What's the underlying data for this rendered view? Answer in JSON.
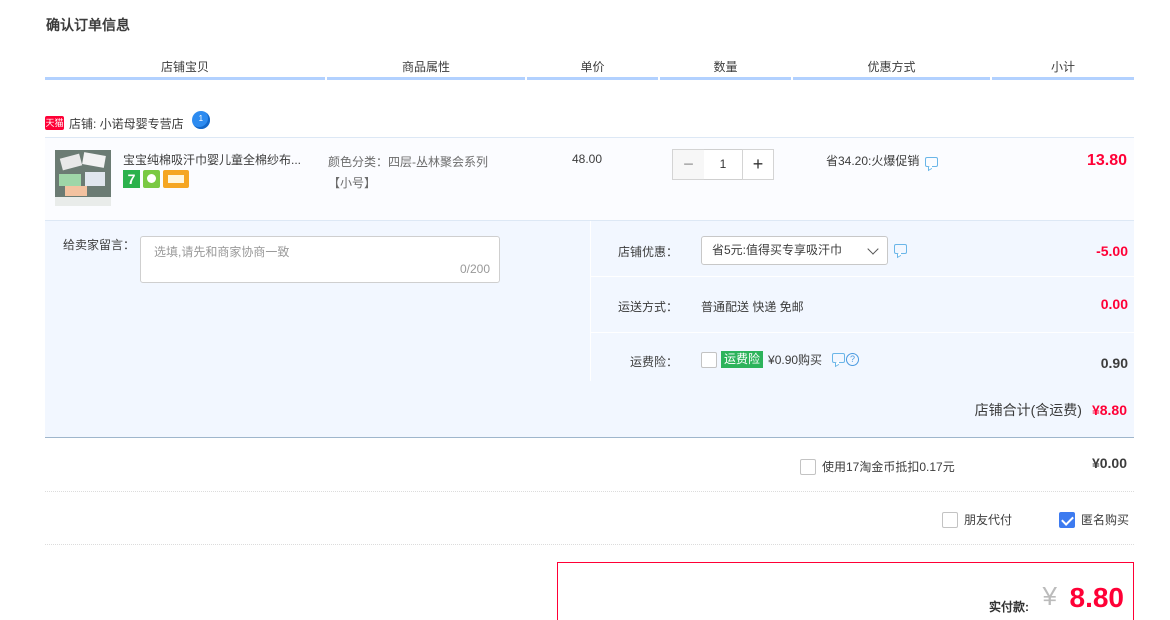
{
  "page": {
    "title": "确认订单信息"
  },
  "columns": [
    "店铺宝贝",
    "商品属性",
    "单价",
    "数量",
    "优惠方式",
    "小计"
  ],
  "shop": {
    "badge": "天猫",
    "label": "店铺: 小诺母婴专营店"
  },
  "item": {
    "title": "宝宝纯棉吸汗巾婴儿童全棉纱布...",
    "attr_line1": "颜色分类：四层-丛林聚会系列",
    "attr_line2": "【小号】",
    "unit_price": "48.00",
    "quantity": "1",
    "minus": "−",
    "plus": "+",
    "discount": "省34.20:火爆促销",
    "subtotal": "13.80",
    "service_icons": [
      "7-day-return-icon",
      "guarantee-icon",
      "credit-card-icon"
    ],
    "service_7": "7"
  },
  "memo": {
    "label": "给卖家留言：",
    "placeholder": "选填,请先和商家协商一致",
    "count": "0/200"
  },
  "options": {
    "coupon": {
      "label": "店铺优惠：",
      "selected": "省5元:值得买专享吸汗巾",
      "amount": "-5.00"
    },
    "shipping": {
      "label": "运送方式：",
      "value": "普通配送 快递 免邮",
      "amount": "0.00"
    },
    "insurance": {
      "label": "运费险：",
      "tag": "运费险",
      "value": "¥0.90购买",
      "amount": "0.90",
      "checked": false
    },
    "shop_total_label": "店铺合计(含运费)",
    "shop_total_amount": "¥8.80"
  },
  "coin": {
    "label": "使用17淘金币抵扣0.17元",
    "amount": "¥0.00",
    "checked": false
  },
  "extras": {
    "friend_pay": {
      "label": "朋友代付",
      "checked": false
    },
    "anonymous": {
      "label": "匿名购买",
      "checked": true
    }
  },
  "payment": {
    "label": "实付款:",
    "currency": "¥",
    "amount": "8.80"
  },
  "colors": {
    "accent": "#ff0036",
    "header_line": "#b2d1ff",
    "panel_bg": "#f2f7ff",
    "checkbox_blue": "#3d7bf0",
    "insurance_green": "#2db35b"
  }
}
